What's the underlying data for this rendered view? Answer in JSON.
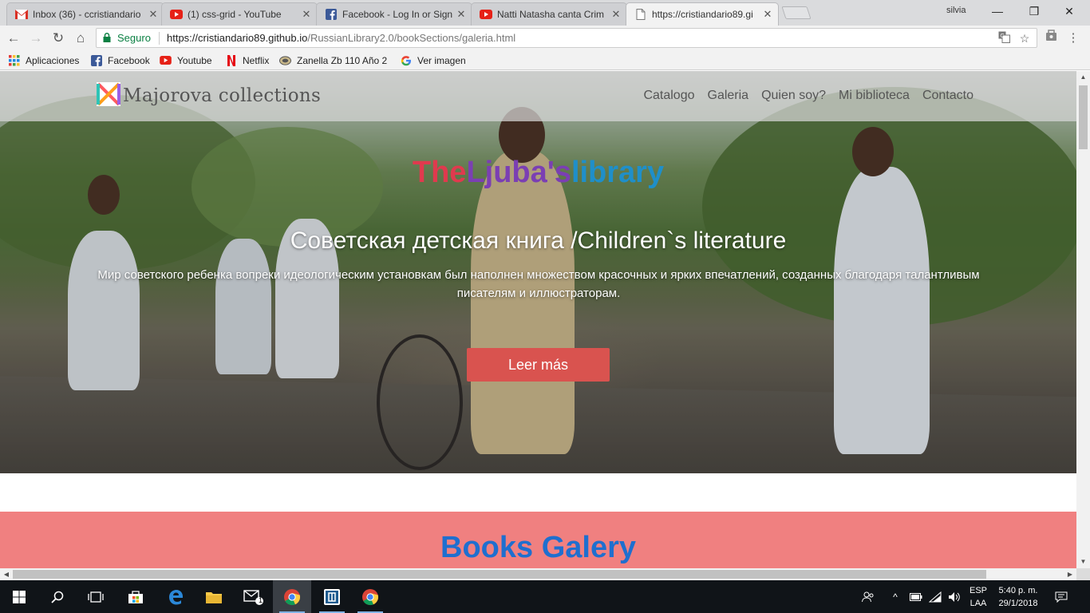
{
  "browser": {
    "tabs": [
      {
        "title": "Inbox (36) - ccristiandario",
        "icon": "gmail-icon"
      },
      {
        "title": "(1) css-grid - YouTube",
        "icon": "youtube-icon"
      },
      {
        "title": "Facebook - Log In or Sign Up",
        "icon": "facebook-icon"
      },
      {
        "title": "Natti Natasha canta Crim",
        "icon": "youtube-icon"
      },
      {
        "title": "https://cristiandario89.gi",
        "icon": "page-icon"
      }
    ],
    "user": "silvia",
    "secure_label": "Seguro",
    "url_host": "https://cristiandario89.github.io",
    "url_path": "/RussianLibrary2.0/bookSections/galeria.html",
    "bookmarks": [
      {
        "label": "Aplicaciones",
        "icon": "apps-grid-icon"
      },
      {
        "label": "Facebook",
        "icon": "facebook-icon"
      },
      {
        "label": "Youtube",
        "icon": "youtube-icon"
      },
      {
        "label": "Netflix",
        "icon": "netflix-icon"
      },
      {
        "label": "Zanella Zb 110 Año 2",
        "icon": "zanella-icon"
      },
      {
        "label": "Ver imagen",
        "icon": "google-icon"
      }
    ]
  },
  "site": {
    "brand": "Majorova collections",
    "nav": [
      "Catalogo",
      "Galeria",
      "Quien soy?",
      "Mi biblioteca",
      "Contacto"
    ],
    "hero_title_parts": [
      "The ",
      "Ljuba's",
      " library"
    ],
    "hero_title_colors": [
      "#e03a4e",
      "#7b3fb3",
      "#1f8fc9"
    ],
    "hero_subtitle": "Советская детская книга /Children`s literature",
    "hero_description": "Мир советского ребенка вопреки идеологическим установкам был наполнен множеством красочных и ярких впечатлений, созданных благодаря талантливым писателям и иллюстраторам.",
    "cta": "Leer más",
    "section_title": "Books Galery"
  },
  "taskbar": {
    "lang_top": "ESP",
    "lang_bottom": "LAA",
    "time": "5:40 p. m.",
    "date": "29/1/2018",
    "mail_badge": "1"
  }
}
